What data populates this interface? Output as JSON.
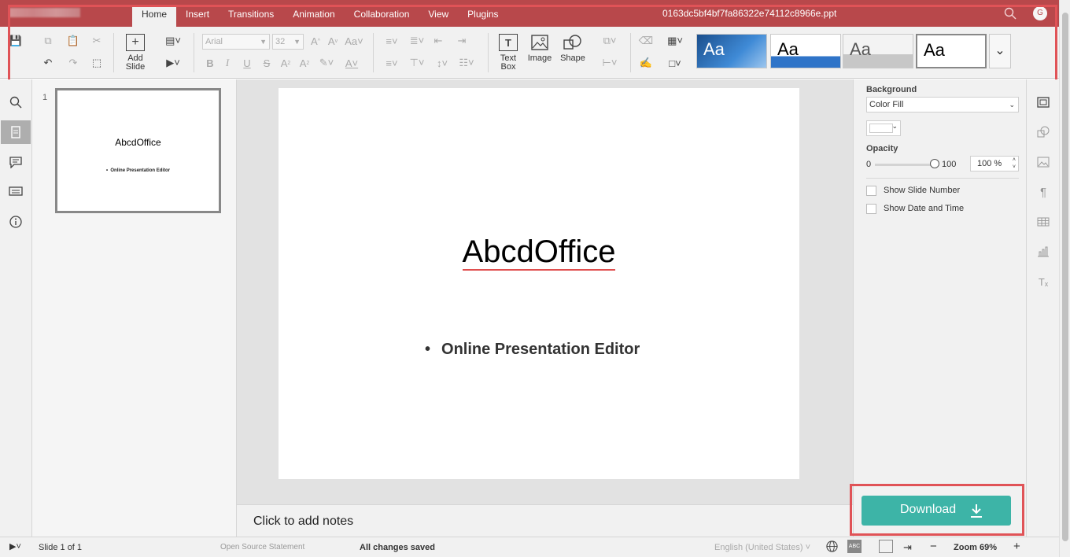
{
  "header": {
    "tabs": [
      "Home",
      "Insert",
      "Transitions",
      "Animation",
      "Collaboration",
      "View",
      "Plugins"
    ],
    "active_tab": "Home",
    "filename": "0163dc5bf4bf7fa86322e74112c8966e.ppt",
    "avatar_initial": "G",
    "accent_color": "#b8484b"
  },
  "toolbar": {
    "add_slide_label": "Add Slide",
    "font_name": "Arial",
    "font_size": "32",
    "text_box_label": "Text Box",
    "image_label": "Image",
    "shape_label": "Shape",
    "theme_label": "Aa"
  },
  "thumbnails": {
    "number": "1",
    "title": "AbcdOffice",
    "bullet": "Online Presentation Editor"
  },
  "slide": {
    "title": "AbcdOffice",
    "bullet": "Online Presentation Editor"
  },
  "notes": {
    "placeholder": "Click to add notes"
  },
  "right_panel": {
    "background_label": "Background",
    "fill_type": "Color Fill",
    "opacity_label": "Opacity",
    "opacity_min": "0",
    "opacity_max": "100",
    "opacity_value": "100 %",
    "show_slide_number": "Show Slide Number",
    "show_date_time": "Show Date and Time"
  },
  "download": {
    "label": "Download",
    "color": "#3db4a7"
  },
  "statusbar": {
    "slide_info": "Slide 1 of 1",
    "open_source": "Open Source Statement",
    "save_status": "All changes saved",
    "language": "English (United States)",
    "zoom": "Zoom 69%"
  }
}
